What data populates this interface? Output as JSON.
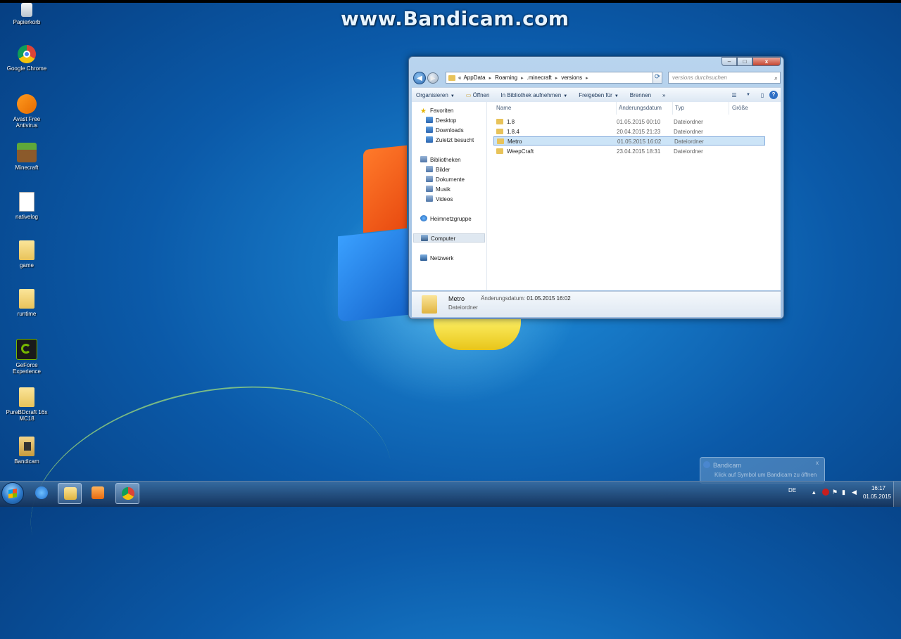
{
  "watermark": "www.Bandicam.com",
  "desktop": {
    "icons": [
      {
        "label": "Papierkorb",
        "icon": "recycle-bin-icon"
      },
      {
        "label": "Google Chrome",
        "icon": "chrome-icon"
      },
      {
        "label": "Avast Free Antivirus",
        "icon": "avast-icon"
      },
      {
        "label": "Minecraft",
        "icon": "minecraft-icon"
      },
      {
        "label": "nativelog",
        "icon": "file-icon"
      },
      {
        "label": "game",
        "icon": "folder-icon"
      },
      {
        "label": "runtime",
        "icon": "folder-icon"
      },
      {
        "label": "GeForce Experience",
        "icon": "nvidia-icon"
      },
      {
        "label": "PureBDcraft 16x MC18",
        "icon": "folder-icon"
      },
      {
        "label": "Bandicam",
        "icon": "bandicam-icon"
      }
    ]
  },
  "explorer": {
    "controls": {
      "minimize": "–",
      "maximize": "□",
      "close": "x"
    },
    "address": {
      "prefix": "«",
      "crumbs": [
        "AppData",
        "Roaming",
        ".minecraft",
        "versions"
      ]
    },
    "search_placeholder": "versions durchsuchen",
    "toolbar": {
      "organize": "Organisieren",
      "open": "Öffnen",
      "library": "In Bibliothek aufnehmen",
      "share": "Freigeben für",
      "burn": "Brennen",
      "more": "»"
    },
    "nav": {
      "favorites": "Favoriten",
      "desktop": "Desktop",
      "downloads": "Downloads",
      "recent": "Zuletzt besucht",
      "libraries": "Bibliotheken",
      "pictures": "Bilder",
      "documents": "Dokumente",
      "music": "Musik",
      "videos": "Videos",
      "homegroup": "Heimnetzgruppe",
      "computer": "Computer",
      "network": "Netzwerk"
    },
    "columns": {
      "name": "Name",
      "date": "Änderungsdatum",
      "type": "Typ",
      "size": "Größe"
    },
    "files": [
      {
        "name": "1.8",
        "date": "01.05.2015 00:10",
        "type": "Dateiordner"
      },
      {
        "name": "1.8.4",
        "date": "20.04.2015 21:23",
        "type": "Dateiordner"
      },
      {
        "name": "Metro",
        "date": "01.05.2015 16:02",
        "type": "Dateiordner"
      },
      {
        "name": "WeepCraft",
        "date": "23.04.2015 18:31",
        "type": "Dateiordner"
      }
    ],
    "details": {
      "name": "Metro",
      "type": "Dateiordner",
      "date_label": "Änderungsdatum:",
      "date_value": "01.05.2015 16:02"
    }
  },
  "notification": {
    "title": "Bandicam",
    "message": "Klick auf Symbol um Bandicam zu öffnen",
    "close": "x"
  },
  "taskbar": {
    "language": "DE",
    "time": "16:17",
    "date": "01.05.2015"
  }
}
